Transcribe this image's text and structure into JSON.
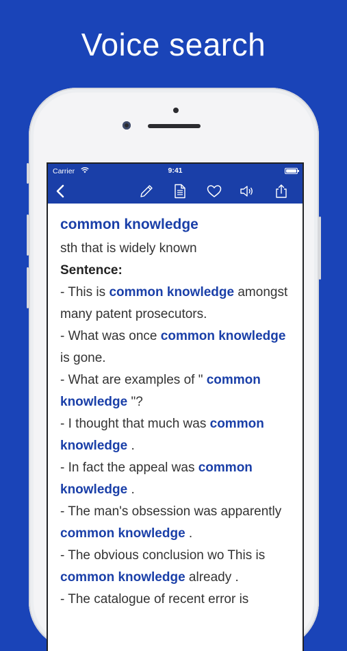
{
  "headline": "Voice search",
  "statusbar": {
    "carrier": "Carrier",
    "time": "9:41"
  },
  "toolbar": {
    "icons": [
      "back-icon",
      "edit-icon",
      "document-icon",
      "heart-icon",
      "speaker-icon",
      "share-icon"
    ]
  },
  "entry": {
    "term": "common knowledge",
    "definition": "sth that is widely known",
    "sentence_label": "Sentence:",
    "examples": [
      {
        "before": "- This is ",
        "highlight": "common knowledge",
        "after": " amongst many patent prosecutors."
      },
      {
        "before": "- What was once ",
        "highlight": "common knowledge",
        "after": " is gone."
      },
      {
        "before": "- What are examples of \" ",
        "highlight": "common knowledge",
        "after": " \"?"
      },
      {
        "before": "- I thought that much was ",
        "highlight": "common knowledge",
        "after": " ."
      },
      {
        "before": "- In fact the appeal was ",
        "highlight": "common knowledge",
        "after": " ."
      },
      {
        "before": "- The man's obsession was apparently ",
        "highlight": "common knowledge",
        "after": " ."
      },
      {
        "before": "- The obvious conclusion wo This is ",
        "highlight": "common knowledge",
        "after": " already ."
      },
      {
        "before": "- The catalogue of recent error is",
        "highlight": "",
        "after": ""
      }
    ]
  },
  "colors": {
    "background": "#1a44b8",
    "bar": "#1a3fa8",
    "highlight": "#1a3fa8"
  }
}
